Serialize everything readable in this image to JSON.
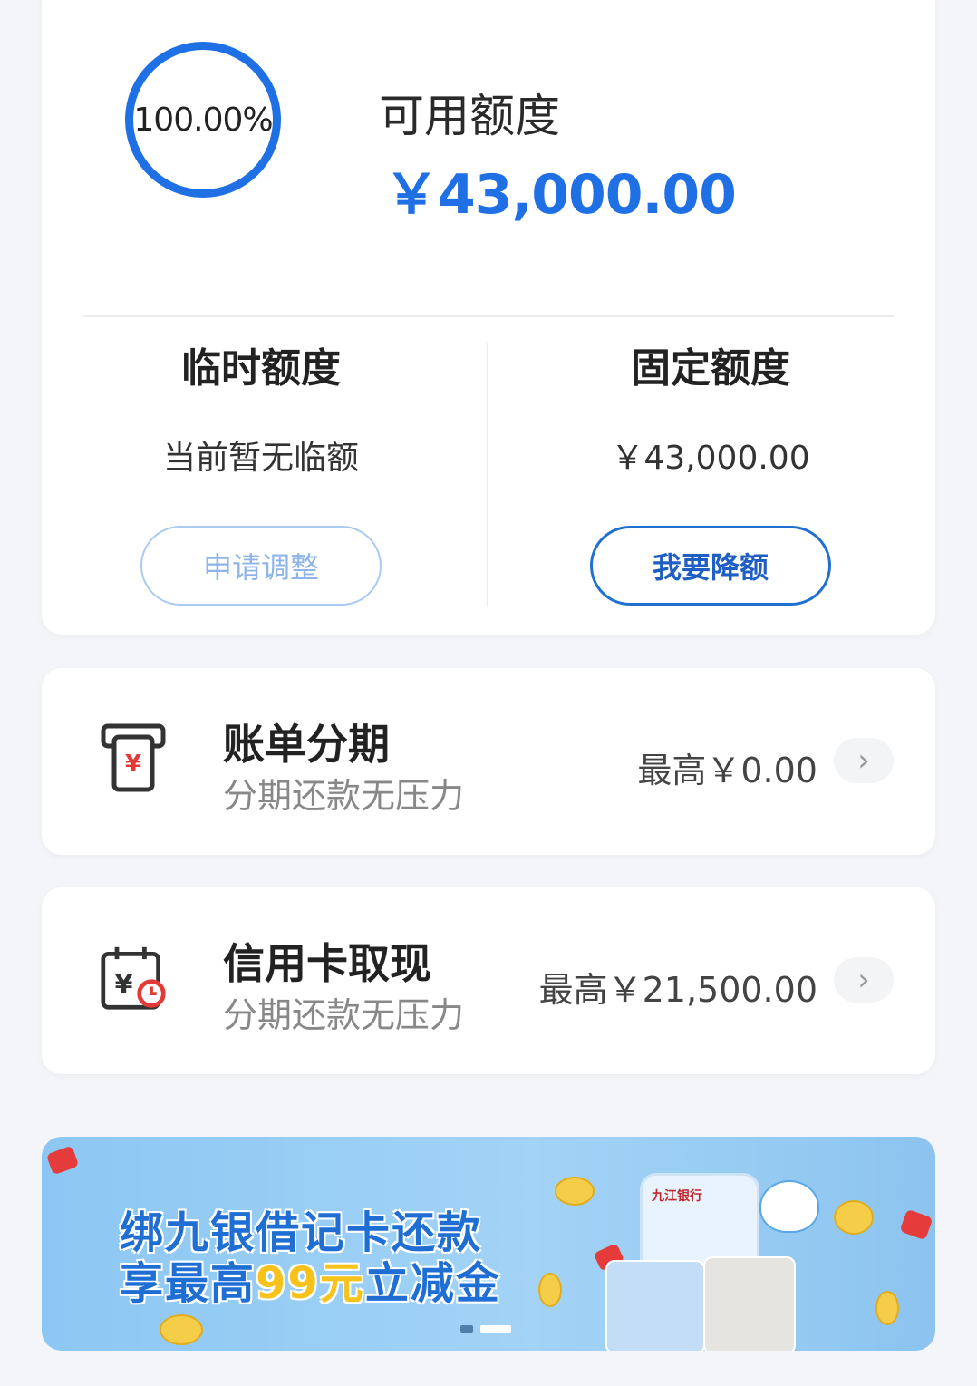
{
  "credit": {
    "usage_percent": "100.00%",
    "available_title": "可用额度",
    "available_amount": "￥43,000.00",
    "temp": {
      "title": "临时额度",
      "value": "当前暂无临额",
      "button": "申请调整"
    },
    "fixed": {
      "title": "固定额度",
      "value": "￥43,000.00",
      "button": "我要降额"
    }
  },
  "installment": {
    "icon": "bill-installment-icon",
    "title": "账单分期",
    "subtitle": "分期还款无压力",
    "amount": "最高￥0.00"
  },
  "cash": {
    "icon": "cash-withdrawal-icon",
    "title": "信用卡取现",
    "subtitle": "分期还款无压力",
    "amount": "最高￥21,500.00"
  },
  "banner": {
    "line1": "绑九银借记卡还款",
    "line2_prefix": "享最高",
    "line2_highlight": "99元",
    "line2_suffix": "立减金",
    "bank_name": "九江银行"
  },
  "colors": {
    "accent": "#1f6fe5",
    "banner_bg": "#a3d3f6",
    "highlight": "#f7c21a"
  }
}
